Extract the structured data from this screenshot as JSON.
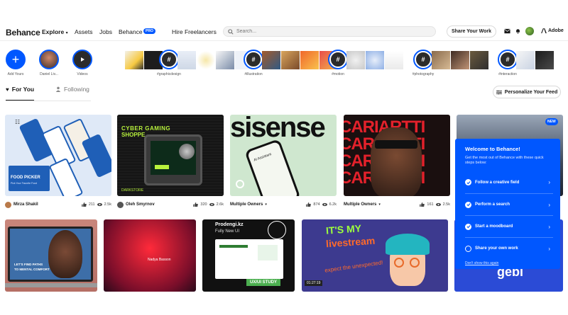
{
  "nav": {
    "logo": "Behance",
    "links": {
      "explore": "Explore",
      "assets": "Assets",
      "jobs": "Jobs",
      "behance": "Behance",
      "pro": "PRO",
      "hire": "Hire Freelancers"
    },
    "search_placeholder": "Search...",
    "share_label": "Share Your Work",
    "adobe_label": "Adobe",
    "icons": [
      "mail-icon",
      "bell-icon",
      "avatar",
      "adobe-icon"
    ]
  },
  "stories": {
    "items": [
      {
        "label": "Add Yours"
      },
      {
        "label": "Daniel Liv..."
      },
      {
        "label": "Videos"
      },
      {
        "label": "#graphicdesign",
        "tag": "#"
      },
      {
        "label": "#illustration",
        "tag": "#"
      },
      {
        "label": "#motion",
        "tag": "#"
      },
      {
        "label": "#photography",
        "tag": "#"
      },
      {
        "label": "#interaction",
        "tag": "#"
      }
    ]
  },
  "tabs": {
    "for_you": "For You",
    "following": "Following",
    "personalize": "Personalize Your Feed"
  },
  "cards_row1": [
    {
      "owner": "Mirza Shakil",
      "likes": "211",
      "views": "2.5k",
      "text1": "FOOD PICKER",
      "text2": "Pick Your Favorite Food"
    },
    {
      "owner": "Oleh Smyrnov",
      "likes": "320",
      "views": "2.6k",
      "text1": "CYBER GAMING",
      "text2": "SHOPPE",
      "text3": "DARKSTORE"
    },
    {
      "owner": "Multiple Owners",
      "likes": "874",
      "views": "6.2k",
      "text1": "sisense",
      "text2": "AI Assistant"
    },
    {
      "owner": "Multiple Owners",
      "likes": "161",
      "views": "2.5k",
      "text1": "CARIARTTI"
    },
    {
      "badge": "NEW"
    }
  ],
  "cards_row2": [
    {
      "text1": "LET'S FIND PATHS",
      "text2": "TO MENTAL COMFORT"
    },
    {
      "text1": "Nadya Basson"
    },
    {
      "text1": "Prodengi.kz",
      "text2": "Fully New UI",
      "text3": "UX/UI STUDY"
    },
    {
      "text1": "IT'S MY",
      "text2": "livestream",
      "text3": "expect the unexpected!",
      "text4": "01:27:19"
    },
    {
      "text1": "gebi"
    }
  ],
  "welcome": {
    "title": "Welcome to Behance!",
    "description": "Get the most out of Behance with these quick steps below:",
    "steps": [
      {
        "label": "Follow a creative field",
        "done": true
      },
      {
        "label": "Perform a search",
        "done": true
      },
      {
        "label": "Start a moodboard",
        "done": true
      },
      {
        "label": "Share your own work",
        "done": false
      }
    ],
    "dont_show": "Don't show this again"
  },
  "colors": {
    "brand": "#0057ff",
    "text": "#191919"
  }
}
